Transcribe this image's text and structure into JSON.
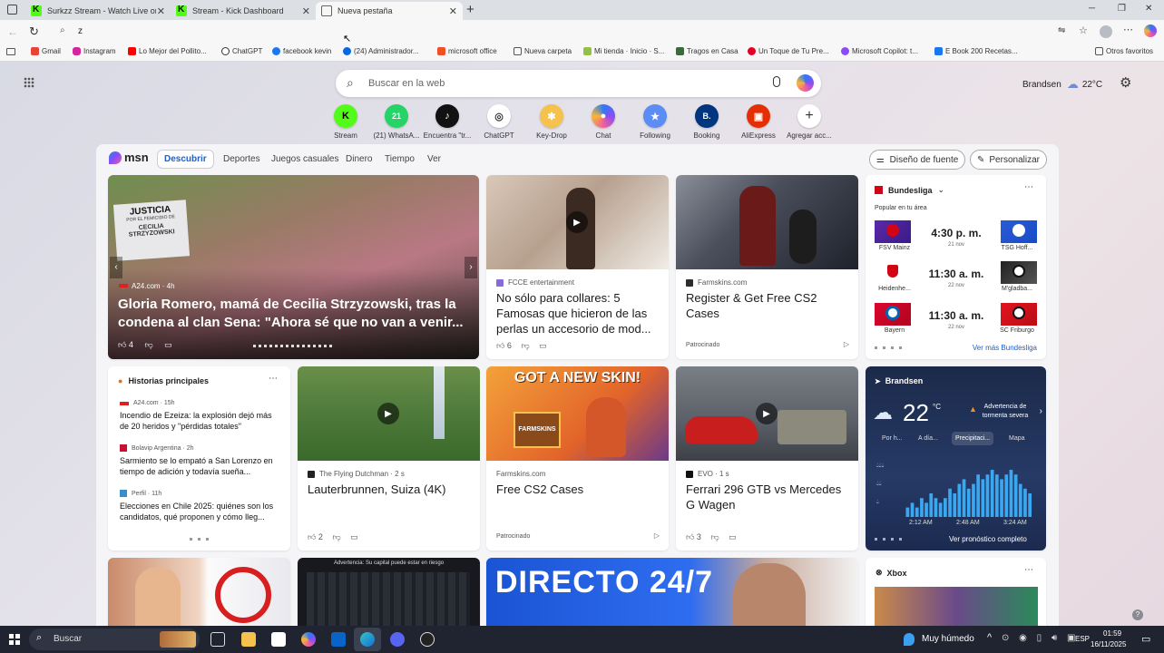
{
  "tabs": [
    {
      "title": "Surkzz Stream - Watch Live on Ki"
    },
    {
      "title": "Stream - Kick Dashboard"
    },
    {
      "title": "Nueva pestaña"
    }
  ],
  "address": {
    "value": "z"
  },
  "bookmarks": [
    "Gmail",
    "Instagram",
    "Lo Mejor del Pollito...",
    "ChatGPT",
    "facebook kevin",
    "(24) Administrador...",
    "microsoft office",
    "Nueva carpeta",
    "Mi tienda · Inicio · S...",
    "Tragos en Casa",
    "Un Toque de Tu Pre...",
    "Microsoft Copilot: t...",
    "E Book 200 Recetas..."
  ],
  "bookmarks_other": "Otros favoritos",
  "search": {
    "placeholder": "Buscar en la web"
  },
  "weather_top": {
    "city": "Brandsen",
    "temp": "22°C"
  },
  "quicklinks": [
    {
      "label": "Stream",
      "glyph": "K",
      "color": "#53fc18"
    },
    {
      "label": "(21) WhatsA...",
      "glyph": "21",
      "color": "#25d366"
    },
    {
      "label": "Encuentra \"tr...",
      "glyph": "♪",
      "color": "#111111"
    },
    {
      "label": "ChatGPT",
      "glyph": "◎",
      "color": "#ffffff"
    },
    {
      "label": "Key-Drop",
      "glyph": "✱",
      "color": "#f4c24d"
    },
    {
      "label": "Chat",
      "glyph": "●",
      "color": "#7a5cff"
    },
    {
      "label": "Following",
      "glyph": "★",
      "color": "#5b8df5"
    },
    {
      "label": "Booking",
      "glyph": "B.",
      "color": "#003580"
    },
    {
      "label": "AliExpress",
      "glyph": "▣",
      "color": "#e62e04"
    },
    {
      "label": "Agregar acc...",
      "glyph": "+",
      "color": "#ffffff"
    }
  ],
  "msn": {
    "logo": "msn",
    "nav": [
      "Descubrir",
      "Deportes",
      "Juegos casuales",
      "Dinero",
      "Tiempo",
      "Ver"
    ],
    "font_btn": "Diseño de fuente",
    "personalize_btn": "Personalizar"
  },
  "hero": {
    "source": "A24.com · 4h",
    "title": "Gloria Romero, mamá de Cecilia Strzyzowski, tras la condena al clan Sena: \"Ahora sé que no van a venir...",
    "likes": "4",
    "sign1": "JUSTICIA",
    "sign2": "POR EL FEMICIDIO DE",
    "sign3": "CECILIA STRZYZOWSKI"
  },
  "card_fcce": {
    "source": "FCCE entertainment",
    "title": "No sólo para collares: 5 Famosas que hicieron de las perlas un accesorio de mod...",
    "likes": "6"
  },
  "card_farm1": {
    "source": "Farmskins.com",
    "title": "Register & Get Free CS2 Cases",
    "sponsored": "Patrocinado"
  },
  "bundesliga": {
    "title": "Bundesliga",
    "subtitle": "Popular en tu área",
    "matches": [
      {
        "home": "FSV Mainz",
        "time": "4:30 p. m.",
        "date": "21 nov",
        "away": "TSG Hoff..."
      },
      {
        "home": "Heidenhe...",
        "time": "11:30 a. m.",
        "date": "22 nov",
        "away": "M'gladba..."
      },
      {
        "home": "Bayern",
        "time": "11:30 a. m.",
        "date": "22 nov",
        "away": "SC Friburgo"
      }
    ],
    "more": "Ver más Bundesliga"
  },
  "top_stories": {
    "title": "Historias principales",
    "items": [
      {
        "source": "A24.com · 15h",
        "title": "Incendio de Ezeiza: la explosión dejó más de 20 heridos y \"pérdidas totales\""
      },
      {
        "source": "Bolavip Argentina · 2h",
        "title": "Sarmiento se lo empató a San Lorenzo en tiempo de adición y todavía sueña..."
      },
      {
        "source": "Perfil · 11h",
        "title": "Elecciones en Chile 2025: quiénes son los candidatos, qué proponen y cómo lleg..."
      }
    ]
  },
  "card_lauter": {
    "source": "The Flying Dutchman · 2 s",
    "title": "Lauterbrunnen, Suiza (4K)",
    "likes": "2"
  },
  "card_farm2": {
    "source": "Farmskins.com",
    "title": "Free CS2 Cases",
    "sponsored": "Patrocinado",
    "banner": "GOT A NEW SKIN!",
    "box": "FARMSKINS"
  },
  "card_evo": {
    "source": "EVO · 1 s",
    "title": "Ferrari 296 GTB vs Mercedes G Wagen",
    "likes": "3"
  },
  "weather_card": {
    "city": "Brandsen",
    "temp": "22",
    "unit": "°C",
    "alert": "Advertencia de tormenta severa",
    "tabs": [
      "Por h...",
      "A día...",
      "Precipitaci...",
      "Mapa"
    ],
    "times": [
      "2:12 AM",
      "2:48 AM",
      "3:24 AM"
    ],
    "precip": [
      2,
      3,
      2,
      4,
      3,
      5,
      4,
      3,
      4,
      6,
      5,
      7,
      8,
      6,
      7,
      9,
      8,
      9,
      10,
      9,
      8,
      9,
      10,
      9,
      7,
      6,
      5
    ],
    "footer": "Ver pronóstico completo"
  },
  "row3": {
    "warn": "Advertencia: Su capital puede estar en riesgo",
    "directo": "DIRECTO 24/7",
    "xbox": "Xbox"
  },
  "taskbar": {
    "search": "Buscar",
    "weather": "Muy húmedo",
    "lang": "ESP",
    "time": "01:59",
    "date": "16/11/2025"
  }
}
